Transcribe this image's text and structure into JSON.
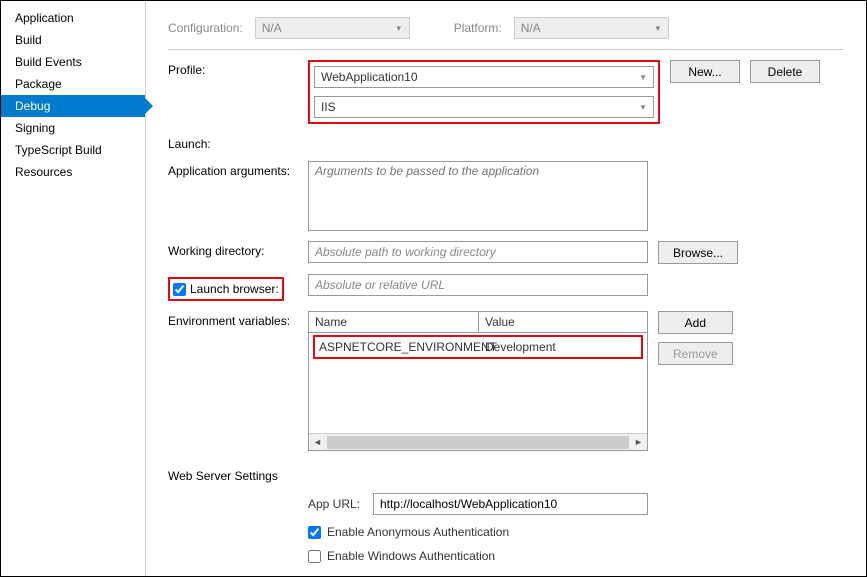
{
  "sidebar": {
    "items": [
      {
        "label": "Application"
      },
      {
        "label": "Build"
      },
      {
        "label": "Build Events"
      },
      {
        "label": "Package"
      },
      {
        "label": "Debug",
        "active": true
      },
      {
        "label": "Signing"
      },
      {
        "label": "TypeScript Build"
      },
      {
        "label": "Resources"
      }
    ]
  },
  "config": {
    "configuration_label": "Configuration:",
    "configuration_value": "N/A",
    "platform_label": "Platform:",
    "platform_value": "N/A"
  },
  "form": {
    "profile_label": "Profile:",
    "profile_value": "WebApplication10",
    "launch_label": "Launch:",
    "launch_value": "IIS",
    "new_btn": "New...",
    "delete_btn": "Delete",
    "appargs_label": "Application arguments:",
    "appargs_placeholder": "Arguments to be passed to the application",
    "workdir_label": "Working directory:",
    "workdir_placeholder": "Absolute path to working directory",
    "browse_btn": "Browse...",
    "launchbrowser_label": "Launch browser:",
    "launchbrowser_placeholder": "Absolute or relative URL",
    "envvars_label": "Environment variables:",
    "add_btn": "Add",
    "remove_btn": "Remove"
  },
  "env_table": {
    "head_name": "Name",
    "head_value": "Value",
    "rows": [
      {
        "name": "ASPNETCORE_ENVIRONMENT",
        "value": "Development"
      }
    ]
  },
  "webserver": {
    "section": "Web Server Settings",
    "appurl_label": "App URL:",
    "appurl_value": "http://localhost/WebApplication10",
    "anon_label": "Enable Anonymous Authentication",
    "win_label": "Enable Windows Authentication"
  }
}
